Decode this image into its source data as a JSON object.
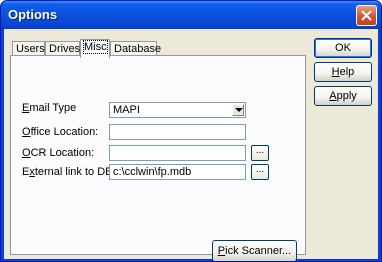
{
  "window": {
    "title": "Options"
  },
  "tabs": [
    {
      "label": "Users"
    },
    {
      "label": "Drives"
    },
    {
      "label": "Misc"
    },
    {
      "label": "Database"
    }
  ],
  "form": {
    "email_type": {
      "label_pre": "",
      "label_u": "E",
      "label_post": "mail Type",
      "value": "MAPI"
    },
    "office_location": {
      "label_pre": "",
      "label_u": "O",
      "label_post": "ffice Location:",
      "value": ""
    },
    "ocr_location": {
      "label_pre": "",
      "label_u": "O",
      "label_post": "CR Location:",
      "value": ""
    },
    "external_link": {
      "label_pre": "E",
      "label_u": "x",
      "label_post": "ternal link to DB:",
      "value": "c:\\cclwin\\fp.mdb"
    },
    "browse_label": "...",
    "pick_scanner": {
      "pre": "",
      "u": "P",
      "post": "ick Scanner..."
    }
  },
  "buttons": {
    "ok": "OK",
    "help": {
      "pre": "",
      "u": "H",
      "post": "elp"
    },
    "apply": {
      "pre": "",
      "u": "A",
      "post": "pply"
    }
  }
}
